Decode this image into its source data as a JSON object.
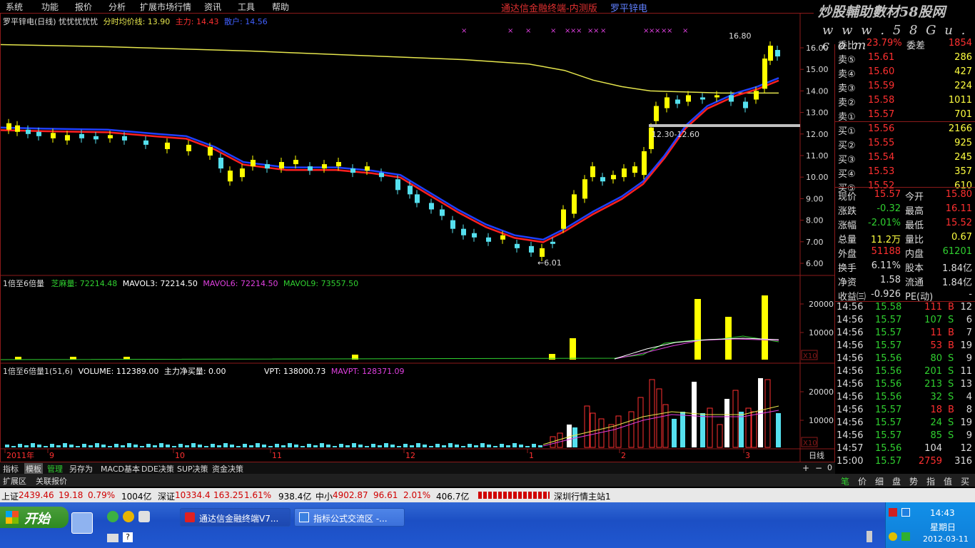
{
  "menu": [
    "系统",
    "功能",
    "报价",
    "分析",
    "扩展市场行情",
    "资讯",
    "工具",
    "帮助"
  ],
  "app_title": "通达信金融终端-内测版",
  "stock_title": "罗平锌电",
  "watermark": {
    "line1": "炒股輔助數材58股网",
    "line2": "w w w . 5 8 G u . c o m"
  },
  "main_chart": {
    "header": {
      "name": "罗平锌电(日线)",
      "tag": "忧忧忧忧忧",
      "avg_label": "分时均价线: 13.90",
      "main_label": "主力: 14.43",
      "scatter_label": "散户: 14.56"
    },
    "price_axis": [
      "16.00",
      "15.00",
      "14.00",
      "13.00",
      "12.00",
      "11.00",
      "10.00",
      "9.00",
      "8.00",
      "7.00",
      "6.00"
    ],
    "annotations": {
      "high": "16.80",
      "low": "6.01",
      "range": "12.30-12.60"
    },
    "colors": {
      "ma_slow": "#e6e64d",
      "ma_red": "#ff2020",
      "ma_blue": "#2040ff",
      "up": "#ffff00",
      "down": "#55e0ee"
    }
  },
  "ind1": {
    "label": "1倍至6倍量",
    "items": [
      {
        "text": "芝麻量: 72214.48",
        "color": "#30d030"
      },
      {
        "text": "MAVOL3: 72214.50",
        "color": "#ffffff"
      },
      {
        "text": "MAVOL6: 72214.50",
        "color": "#e040e0"
      },
      {
        "text": "MAVOL9: 73557.50",
        "color": "#30d030"
      }
    ],
    "axis": [
      "20000",
      "10000"
    ],
    "unit": "X10"
  },
  "ind2": {
    "label": "1倍至6倍量1(51,6)",
    "items": [
      {
        "text": "VOLUME: 112389.00",
        "color": "#ffffff"
      },
      {
        "text": "主力净买量: 0.00",
        "color": "#ffffff"
      },
      {
        "text": "VPT: 138000.73",
        "color": "#ffffff"
      },
      {
        "text": "MAVPT: 128371.09",
        "color": "#e040e0"
      }
    ],
    "axis": [
      "20000",
      "10000"
    ],
    "unit": "X10"
  },
  "time_axis": [
    "2011年",
    "9",
    "10",
    "11",
    "12",
    "1",
    "2",
    "3"
  ],
  "period": "日线",
  "quote": {
    "top_partial": [
      "委比",
      "23.79%",
      "委差",
      "1854"
    ],
    "sell": [
      {
        "label": "卖⑤",
        "price": "15.61",
        "vol": "286"
      },
      {
        "label": "卖④",
        "price": "15.60",
        "vol": "427"
      },
      {
        "label": "卖③",
        "price": "15.59",
        "vol": "224"
      },
      {
        "label": "卖②",
        "price": "15.58",
        "vol": "1011"
      },
      {
        "label": "卖①",
        "price": "15.57",
        "vol": "701"
      }
    ],
    "buy": [
      {
        "label": "买①",
        "price": "15.56",
        "vol": "2166"
      },
      {
        "label": "买②",
        "price": "15.55",
        "vol": "925"
      },
      {
        "label": "买③",
        "price": "15.54",
        "vol": "245"
      },
      {
        "label": "买④",
        "price": "15.53",
        "vol": "357"
      },
      {
        "label": "买⑤",
        "price": "15.52",
        "vol": "610"
      }
    ],
    "stats": [
      [
        "现价",
        "15.57",
        "今开",
        "15.80"
      ],
      [
        "涨跌",
        "-0.32",
        "最高",
        "16.11"
      ],
      [
        "涨幅",
        "-2.01%",
        "最低",
        "15.52"
      ],
      [
        "总量",
        "11.2万",
        "量比",
        "0.67"
      ],
      [
        "外盘",
        "51188",
        "内盘",
        "61201"
      ],
      [
        "换手",
        "6.11%",
        "股本",
        "1.84亿"
      ],
      [
        "净资",
        "1.58",
        "流通",
        "1.84亿"
      ],
      [
        "收益㈢",
        "-0.926",
        "PE(动)",
        "-"
      ]
    ]
  },
  "ticks": [
    {
      "time": "14:56",
      "price": "15.58",
      "vol": "111",
      "bs": "B",
      "n": "12"
    },
    {
      "time": "14:56",
      "price": "15.57",
      "vol": "107",
      "bs": "S",
      "n": "6"
    },
    {
      "time": "14:56",
      "price": "15.57",
      "vol": "11",
      "bs": "B",
      "n": "7"
    },
    {
      "time": "14:56",
      "price": "15.57",
      "vol": "53",
      "bs": "B",
      "n": "19"
    },
    {
      "time": "14:56",
      "price": "15.56",
      "vol": "80",
      "bs": "S",
      "n": "9"
    },
    {
      "time": "14:56",
      "price": "15.56",
      "vol": "201",
      "bs": "S",
      "n": "11"
    },
    {
      "time": "14:56",
      "price": "15.56",
      "vol": "213",
      "bs": "S",
      "n": "13"
    },
    {
      "time": "14:56",
      "price": "15.56",
      "vol": "32",
      "bs": "S",
      "n": "4"
    },
    {
      "time": "14:56",
      "price": "15.57",
      "vol": "18",
      "bs": "B",
      "n": "8"
    },
    {
      "time": "14:56",
      "price": "15.57",
      "vol": "24",
      "bs": "S",
      "n": "19"
    },
    {
      "time": "14:56",
      "price": "15.57",
      "vol": "85",
      "bs": "S",
      "n": "9"
    },
    {
      "time": "14:57",
      "price": "15.56",
      "vol": "104",
      "bs": "",
      "n": "12"
    },
    {
      "time": "15:00",
      "price": "15.57",
      "vol": "2759",
      "bs": "",
      "n": "316"
    }
  ],
  "bottom_tabs": [
    "指标",
    "模板",
    "管理",
    "另存为",
    "MACD基本",
    "DDE决策",
    "SUP决策",
    "资金决策"
  ],
  "ext_tabs": [
    "扩展区",
    "关联报价"
  ],
  "right_tabs": [
    "笔",
    "价",
    "细",
    "盘",
    "势",
    "指",
    "值",
    "买"
  ],
  "status": {
    "sh_label": "上证",
    "sh_val": "2439.46",
    "sh_chg": "19.18",
    "sh_pct": "0.79%",
    "sh_amt": "1004亿",
    "sz_label": "深证",
    "sz_val": "10334.4",
    "sz_chg": "163.25",
    "sz_pct": "1.61%",
    "sz_amt": "938.4亿",
    "zx_label": "中小",
    "zx_val": "4902.87",
    "zx_chg": "96.61",
    "zx_pct": "2.01%",
    "zx_amt": "406.7亿",
    "server": "深圳行情主站1"
  },
  "taskbar": {
    "start": "开始",
    "tasks": [
      "通达信金融终端V7...",
      "指标公式交流区 -..."
    ],
    "time": "14:43",
    "day": "星期日",
    "date": "2012-03-11"
  }
}
